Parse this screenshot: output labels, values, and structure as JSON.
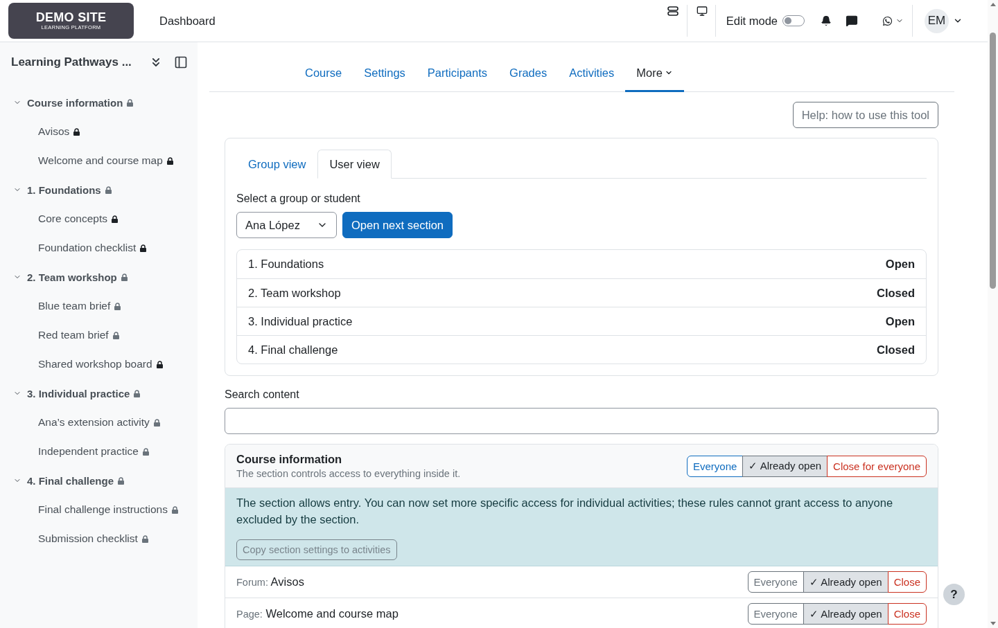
{
  "navbar": {
    "logo": {
      "title": "DEMO SITE",
      "subtitle": "LEARNING PLATFORM"
    },
    "links": [
      {
        "label": "Dashboard"
      }
    ],
    "edit_mode": {
      "label": "Edit mode",
      "on": false
    },
    "avatar": "EM"
  },
  "sidebar": {
    "title": "Learning Pathways ...",
    "sections": [
      {
        "label": "Course information",
        "expanded": true,
        "lock_dark": false,
        "children": [
          {
            "label": "Avisos",
            "lock_dark": true
          },
          {
            "label": "Welcome and course map",
            "lock_dark": true
          }
        ]
      },
      {
        "label": "1. Foundations",
        "expanded": true,
        "lock_dark": false,
        "children": [
          {
            "label": "Core concepts",
            "lock_dark": true
          },
          {
            "label": "Foundation checklist",
            "lock_dark": true
          }
        ]
      },
      {
        "label": "2. Team workshop",
        "expanded": true,
        "lock_dark": false,
        "children": [
          {
            "label": "Blue team brief",
            "lock_dark": false
          },
          {
            "label": "Red team brief",
            "lock_dark": false
          },
          {
            "label": "Shared workshop board",
            "lock_dark": true
          }
        ]
      },
      {
        "label": "3. Individual practice",
        "expanded": true,
        "lock_dark": false,
        "children": [
          {
            "label": "Ana’s extension activity",
            "lock_dark": false
          },
          {
            "label": "Independent practice",
            "lock_dark": false
          }
        ]
      },
      {
        "label": "4. Final challenge",
        "expanded": true,
        "lock_dark": false,
        "children": [
          {
            "label": "Final challenge instructions",
            "lock_dark": false
          },
          {
            "label": "Submission checklist",
            "lock_dark": false
          }
        ]
      }
    ]
  },
  "course_nav": {
    "tabs": [
      {
        "label": "Course",
        "kind": "link",
        "selected": false
      },
      {
        "label": "Settings",
        "kind": "link",
        "selected": false
      },
      {
        "label": "Participants",
        "kind": "link",
        "selected": false
      },
      {
        "label": "Grades",
        "kind": "link",
        "selected": false
      },
      {
        "label": "Activities",
        "kind": "link",
        "selected": false
      },
      {
        "label": "More",
        "kind": "menu",
        "selected": true
      }
    ]
  },
  "help_button": "Help: how to use this tool",
  "access_panel": {
    "tabs": [
      {
        "label": "Group view",
        "selected": false
      },
      {
        "label": "User view",
        "selected": true
      }
    ],
    "selector": {
      "label": "Select a group or student",
      "value": "Ana López"
    },
    "primary_button": "Open next section",
    "sections": [
      {
        "name": "1. Foundations",
        "status": "Open"
      },
      {
        "name": "2. Team workshop",
        "status": "Closed"
      },
      {
        "name": "3. Individual practice",
        "status": "Open"
      },
      {
        "name": "4. Final challenge",
        "status": "Closed"
      }
    ]
  },
  "search": {
    "label": "Search content"
  },
  "section_block": {
    "title": "Course information",
    "subtitle": "The section controls access to everything inside it.",
    "options": [
      {
        "label": "Everyone",
        "kind": "primary",
        "selected": false
      },
      {
        "label": "✓ Already open",
        "kind": "neutral",
        "selected": true
      },
      {
        "label": "Close for everyone",
        "kind": "danger",
        "selected": false
      }
    ],
    "notice": {
      "text": "The section allows entry. You can now set more specific access for individual activities; these rules cannot grant access to anyone excluded by the section.",
      "button": {
        "label": "Copy section settings to activities",
        "disabled": true
      }
    },
    "activities": [
      {
        "type": "Forum:",
        "name": "Avisos",
        "options": [
          {
            "label": "Everyone",
            "kind": "neutral",
            "selected": false
          },
          {
            "label": "✓ Already open",
            "kind": "neutral",
            "selected": true
          },
          {
            "label": "Close",
            "kind": "danger",
            "selected": false
          }
        ]
      },
      {
        "type": "Page:",
        "name": "Welcome and course map",
        "options": [
          {
            "label": "Everyone",
            "kind": "neutral",
            "selected": false
          },
          {
            "label": "✓ Already open",
            "kind": "neutral",
            "selected": true
          },
          {
            "label": "Close",
            "kind": "danger",
            "selected": false
          }
        ]
      }
    ]
  },
  "help_fab": "?"
}
